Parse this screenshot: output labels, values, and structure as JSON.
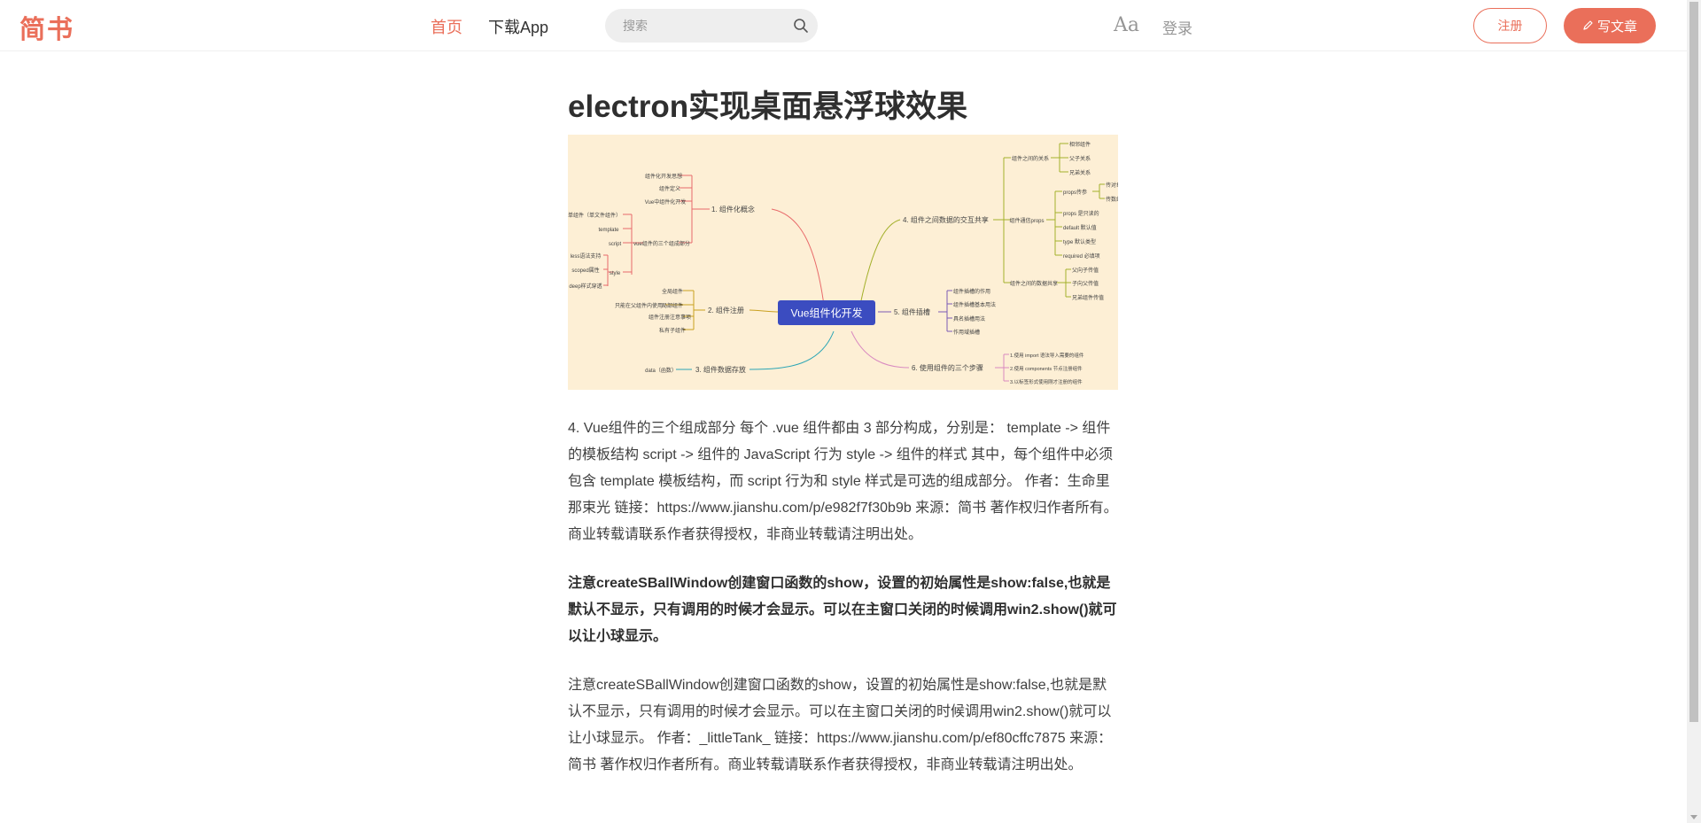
{
  "header": {
    "logo": "简书",
    "nav_home": "首页",
    "nav_app": "下载App",
    "search_placeholder": "搜索",
    "font_toggle_label": "Aa",
    "login": "登录",
    "signup": "注册",
    "write": "写文章"
  },
  "colors": {
    "accent": "#ea6f5a",
    "mindmap_background": "#fdefd5",
    "mindmap_center": "#3b4cc0"
  },
  "article": {
    "title": "electron实现桌面悬浮球效果",
    "mindmap": {
      "center": "Vue组件化开发",
      "branches": {
        "b1": {
          "label": "1. 组件化概念",
          "leaves": [
            "组件化开发思想",
            "组件定义",
            "Vue中组件化开发",
            "vue组件的三个组成部分"
          ]
        },
        "b1_sub": {
          "leaves": [
            "单组件（单文件组件）",
            "template",
            "script",
            "style"
          ],
          "style_sub": [
            "less语法支持",
            "scoped属性",
            "deep样式穿透"
          ]
        },
        "b2": {
          "label": "2. 组件注册",
          "leaves": [
            "全局组件",
            "局部组件",
            "组件注册注意事项",
            "私有子组件"
          ],
          "extra": "只能在父组件内使用"
        },
        "b3": {
          "label": "3. 组件数据存放",
          "leaves": [
            "data（函数）"
          ]
        },
        "b4": {
          "label": "4. 组件之间数据的交互共享",
          "leaves": [
            "组件之间的关系",
            "组件通信props",
            "组件之间的数据共享"
          ],
          "relations": [
            "相邻组件",
            "父子关系",
            "兄弟关系"
          ],
          "props": [
            "props传参",
            "props 是只读的",
            "default 默认值",
            "type 默认类型",
            "required 必填项"
          ],
          "props_sub": [
            "传对象",
            "传数组"
          ],
          "share": [
            "父向子传值",
            "子向父传值",
            "兄弟组件传值"
          ]
        },
        "b5": {
          "label": "5. 组件插槽",
          "leaves": [
            "组件插槽的作用",
            "组件插槽基本用法",
            "具名插槽用法",
            "作用域插槽"
          ]
        },
        "b6": {
          "label": "6. 使用组件的三个步骤",
          "leaves": [
            "1.使用 import 语法导入需要的组件",
            "2.使用 components 节点注册组件",
            "3.以标签形式使用刚才注册的组件"
          ]
        }
      }
    },
    "paragraphs": [
      "4. Vue组件的三个组成部分 每个 .vue 组件都由 3 部分构成，分别是： template -> 组件的模板结构 script -> 组件的 JavaScript 行为 style -> 组件的样式 其中，每个组件中必须包含 template 模板结构，而 script 行为和 style 样式是可选的组成部分。 作者：生命里那束光 链接：https://www.jianshu.com/p/e982f7f30b9b 来源：简书 著作权归作者所有。商业转载请联系作者获得授权，非商业转载请注明出处。",
      "注意createSBallWindow创建窗口函数的show，设置的初始属性是show:false,也就是默认不显示，只有调用的时候才会显示。可以在主窗口关闭的时候调用win2.show()就可以让小球显示。",
      "注意createSBallWindow创建窗口函数的show，设置的初始属性是show:false,也就是默认不显示，只有调用的时候才会显示。可以在主窗口关闭的时候调用win2.show()就可以让小球显示。 作者：_littleTank_ 链接：https://www.jianshu.com/p/ef80cffc7875 来源：简书 著作权归作者所有。商业转载请联系作者获得授权，非商业转载请注明出处。"
    ]
  }
}
